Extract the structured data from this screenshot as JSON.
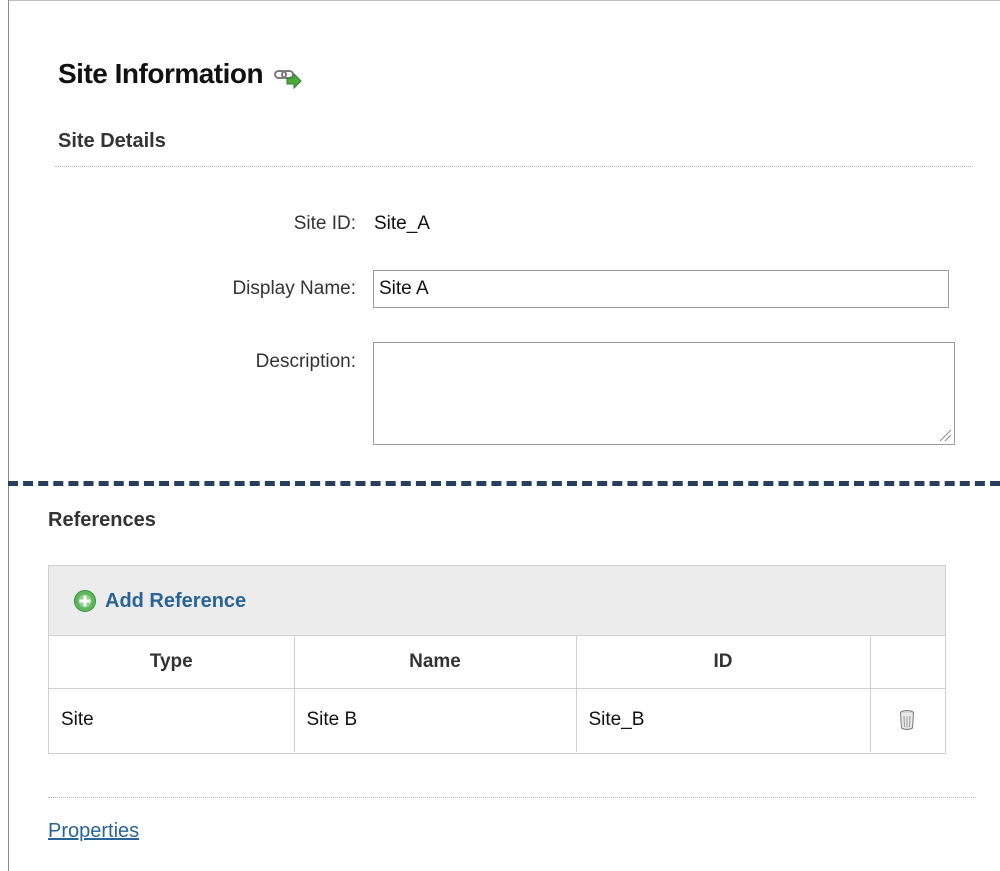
{
  "page": {
    "title": "Site Information",
    "icon": "link-arrow-icon"
  },
  "site_details": {
    "title": "Site Details",
    "site_id_label": "Site ID:",
    "site_id_value": "Site_A",
    "display_name_label": "Display Name:",
    "display_name_value": "Site A",
    "description_label": "Description:",
    "description_value": ""
  },
  "references": {
    "title": "References",
    "add_label": "Add Reference",
    "columns": [
      "Type",
      "Name",
      "ID",
      ""
    ],
    "rows": [
      {
        "type": "Site",
        "name": "Site B",
        "id": "Site_B",
        "action_icon": "trash-icon"
      }
    ]
  },
  "footer": {
    "properties_link": "Properties"
  },
  "colors": {
    "link": "#2a6496",
    "divider": "#283e5f",
    "add_icon": "#5cb85c"
  }
}
